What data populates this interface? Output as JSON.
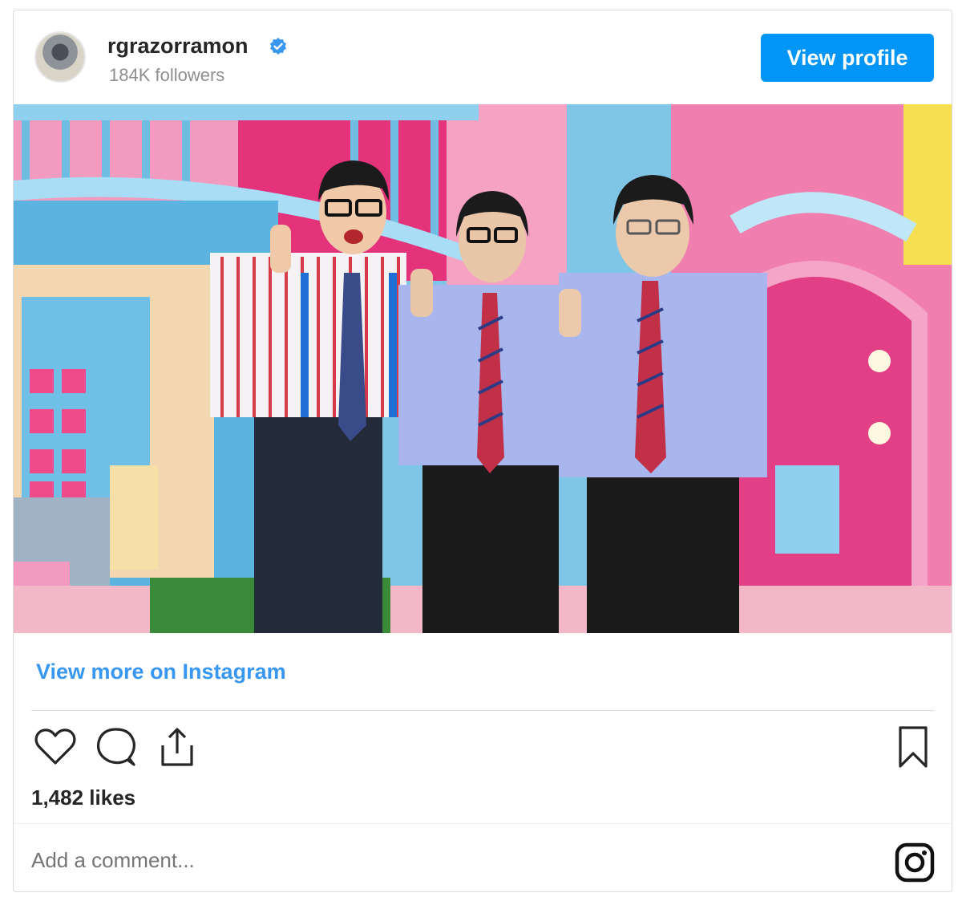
{
  "header": {
    "username": "rgrazorramon",
    "followers": "184K followers",
    "view_profile_label": "View profile",
    "avatar_icon": "avatar-image",
    "verified_icon": "verified-badge-icon"
  },
  "post": {
    "photo_icon": "post-photo",
    "view_more_label": "View more on Instagram",
    "likes": "1,482 likes",
    "comment_placeholder": "Add a comment..."
  },
  "actions": {
    "like_icon": "heart-icon",
    "comment_icon": "comment-icon",
    "share_icon": "share-icon",
    "save_icon": "bookmark-icon",
    "instagram_icon": "instagram-icon"
  },
  "colors": {
    "accent": "#0095f6",
    "link": "#3897f0",
    "muted": "#8e8e8e",
    "text": "#262626"
  }
}
